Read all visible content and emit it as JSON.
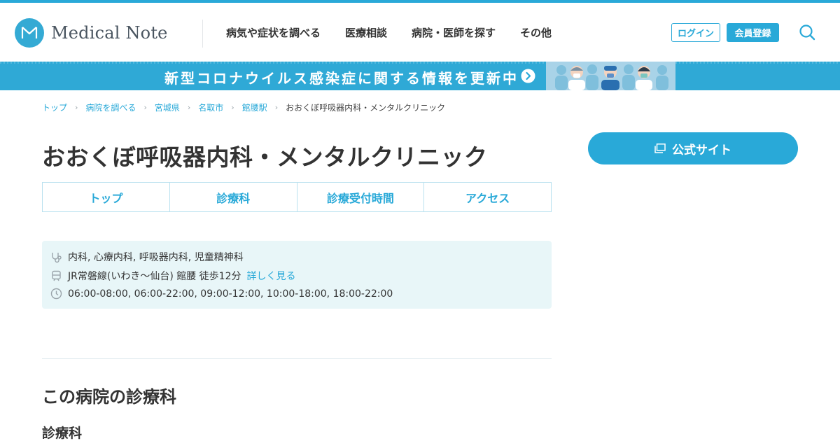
{
  "header": {
    "logo_text": "Medical Note",
    "nav": [
      {
        "label": "病気や症状を調べる"
      },
      {
        "label": "医療相談"
      },
      {
        "label": "病院・医師を探す"
      },
      {
        "label": "その他"
      }
    ],
    "login_label": "ログイン",
    "register_label": "会員登録",
    "search_icon": "search-icon"
  },
  "banner": {
    "text": "新型コロナウイルス感染症に関する情報を更新中",
    "arrow_icon": "chevron-right-circle-icon",
    "illustration": "medical-staff-illustration"
  },
  "breadcrumb": [
    {
      "label": "トップ"
    },
    {
      "label": "病院を調べる"
    },
    {
      "label": "宮城県"
    },
    {
      "label": "名取市"
    },
    {
      "label": "館腰駅"
    }
  ],
  "breadcrumb_current": "おおくぼ呼吸器内科・メンタルクリニック",
  "page_title": "おおくぼ呼吸器内科・メンタルクリニック",
  "official_site_label": "公式サイト",
  "tabs": [
    {
      "label": "トップ"
    },
    {
      "label": "診療科"
    },
    {
      "label": "診療受付時間"
    },
    {
      "label": "アクセス"
    }
  ],
  "info": {
    "departments": "内科, 心療内科, 呼吸器内科, 児童精神科",
    "access": "JR常磐線(いわき～仙台) 館腰 徒歩12分",
    "access_link": "詳しく見る",
    "hours": "06:00-08:00, 06:00-22:00, 09:00-12:00, 10:00-18:00, 18:00-22:00"
  },
  "section_title": "この病院の診療科",
  "sub_title": "診療科",
  "colors": {
    "accent": "#29a9d8",
    "info_bg": "#e8f6f8",
    "text": "#333333"
  }
}
